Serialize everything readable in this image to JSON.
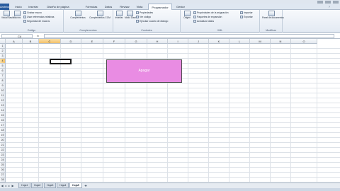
{
  "ribbon_tabs": [
    "Archivo",
    "Inicio",
    "Insertar",
    "Diseño de página",
    "Fórmulas",
    "Datos",
    "Revisar",
    "Vista",
    "Programador",
    "Gestor"
  ],
  "active_tab": "Programador",
  "groups": {
    "codigo": {
      "label": "Código",
      "big": [
        "Visual Basic",
        "Macros"
      ],
      "small": [
        "Grabar macro",
        "Usar referencias relativas",
        "Seguridad de macros"
      ]
    },
    "complementos": {
      "label": "Complementos",
      "big": [
        "Complementos",
        "Complementos COM"
      ]
    },
    "controles": {
      "label": "Controles",
      "big": [
        "Insertar",
        "Modo Diseño"
      ],
      "small": [
        "Propiedades",
        "Ver código",
        "Ejecutar cuadro de diálogo"
      ]
    },
    "xml": {
      "label": "XML",
      "big": [
        "Origen"
      ],
      "small": [
        "Propiedades de la asignación",
        "Paquetes de expansión",
        "Actualizar datos",
        "Importar",
        "Exportar"
      ]
    },
    "modificar": {
      "label": "Modificar",
      "big": [
        "Panel de documentos"
      ]
    }
  },
  "namebox": "C4",
  "fx": "fx",
  "columns": [
    "A",
    "B",
    "C",
    "D",
    "E",
    "F",
    "G",
    "H",
    "I",
    "J",
    "K",
    "L",
    "M",
    "N",
    "O"
  ],
  "rows": [
    "1",
    "2",
    "3",
    "4",
    "5",
    "6",
    "7",
    "8",
    "9",
    "10",
    "11",
    "12",
    "13",
    "14",
    "15",
    "16",
    "17",
    "18",
    "19",
    "20",
    "21",
    "22",
    "23",
    "24",
    "25",
    "26",
    "27",
    "28"
  ],
  "selected_column": "C",
  "selected_row": "4",
  "macro_button_label": "Apagar",
  "sheets": [
    "Hoja1",
    "Hoja2",
    "Hoja3",
    "Hoja4",
    "Hoja5"
  ],
  "active_sheet": "Hoja5",
  "colors": {
    "button_fill": "#e98ce3",
    "file_tab": "#2a5d9f",
    "selection": "#f3c26a"
  }
}
